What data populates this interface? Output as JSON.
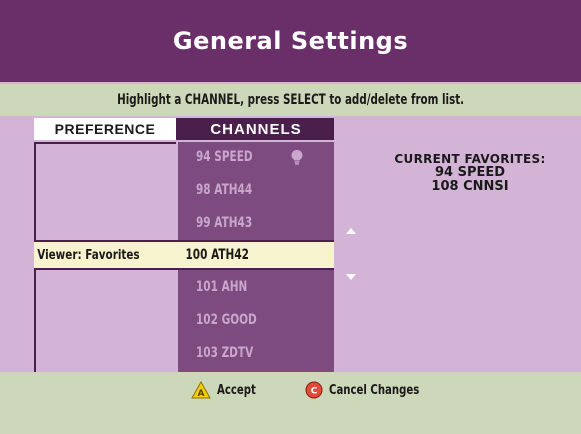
{
  "header": {
    "title": "General Settings"
  },
  "instruction": "Highlight a CHANNEL, press SELECT to add/delete from list.",
  "tabs": {
    "preference": "PREFERENCE",
    "channels": "CHANNELS"
  },
  "preference": {
    "selected_label": "Viewer: Favorites"
  },
  "channels": [
    {
      "label": "94 SPEED",
      "favorite": true
    },
    {
      "label": "98 ATH44",
      "favorite": false
    },
    {
      "label": "99 ATH43",
      "favorite": false
    },
    {
      "label": "100 ATH42",
      "favorite": false,
      "selected": true
    },
    {
      "label": "101 AHN",
      "favorite": false
    },
    {
      "label": "102 GOOD",
      "favorite": false
    },
    {
      "label": "103 ZDTV",
      "favorite": false
    }
  ],
  "favorites": {
    "title": "CURRENT FAVORITES:",
    "items": [
      "94  SPEED",
      "108  CNNSI"
    ]
  },
  "footer": {
    "accept_label": "Accept",
    "cancel_label": "Cancel Changes"
  },
  "colors": {
    "header": "#6a2f68",
    "background": "#d4b4d6",
    "channel_column": "#7d4b80",
    "bar": "#cdd7b9",
    "highlight": "#f6f3ce",
    "accept_icon": "#f2d100",
    "cancel_icon": "#e04a3a"
  }
}
